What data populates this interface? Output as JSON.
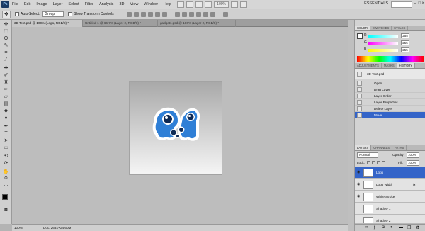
{
  "menubar": {
    "logo": "Ps",
    "items": [
      "File",
      "Edit",
      "Image",
      "Layer",
      "Select",
      "Filter",
      "Analysis",
      "3D",
      "View",
      "Window",
      "Help"
    ],
    "zoom": "100%",
    "workspace": "ESSENTIALS",
    "win_controls": [
      "–",
      "□",
      "×"
    ]
  },
  "options": {
    "auto_select_label": "Auto-Select:",
    "auto_select_value": "Group",
    "transform_label": "Show Transform Controls"
  },
  "tabs": [
    {
      "label": "3D Text.psd @ 100% (Logo, RGB/8) *"
    },
    {
      "label": "Untitled-1 @ 66.7% (Layer 2, RGB/8) *"
    },
    {
      "label": "gadgets.psd @ 100% (Layer 2, RGB/8) *"
    }
  ],
  "statusbar": {
    "zoom": "100%",
    "doc": "Doc: 263.7K/4.60M"
  },
  "panels": {
    "color_tabs": [
      "COLOR",
      "SWATCHES",
      "STYLES"
    ],
    "sliders": [
      {
        "label": "R",
        "value": "255",
        "color": "#00c8c8"
      },
      {
        "label": "G",
        "value": "255",
        "color": "#e040e0"
      },
      {
        "label": "B",
        "value": "255",
        "color": "#e8e800"
      }
    ],
    "adj_tabs": [
      "ADJUSTMENTS",
      "MASKS",
      "HISTORY"
    ],
    "history_snapshot": "3D Text.psd",
    "history": [
      "Open",
      "Drag Layer",
      "Layer Order",
      "Layer Properties",
      "Delete Layer",
      "Move"
    ],
    "layers_tabs": [
      "LAYERS",
      "CHANNELS",
      "PATHS"
    ],
    "blend_mode": "Normal",
    "opacity_label": "Opacity:",
    "opacity": "100%",
    "lock_label": "Lock:",
    "fill_label": "Fill:",
    "fill": "100%",
    "layers": [
      {
        "name": "Logo",
        "visible": true,
        "selected": true,
        "fx": ""
      },
      {
        "name": "Logo Width",
        "visible": true,
        "selected": false,
        "fx": "fx"
      },
      {
        "name": "White Stroke",
        "visible": true,
        "selected": false,
        "fx": ""
      },
      {
        "name": "Shadow 1",
        "visible": false,
        "selected": false,
        "fx": ""
      },
      {
        "name": "Shadow 2",
        "visible": false,
        "selected": false,
        "fx": ""
      }
    ]
  },
  "colors": {
    "accent": "#3464c8",
    "logo_blue": "#2f7fd6"
  }
}
